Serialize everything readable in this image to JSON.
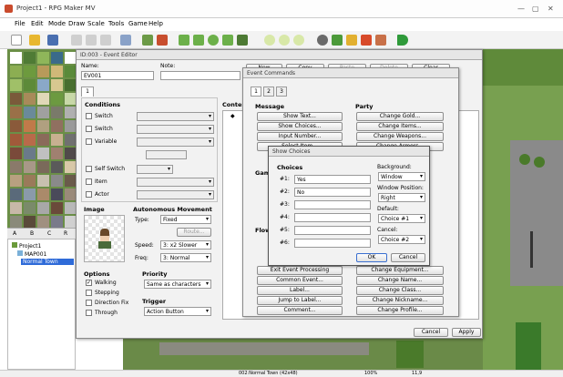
{
  "window": {
    "title": "Project1 - RPG Maker MV",
    "controls": [
      "—",
      "▢",
      "✕"
    ]
  },
  "menu": [
    "File",
    "Edit",
    "Mode",
    "Draw",
    "Scale",
    "Tools",
    "Game",
    "Help"
  ],
  "tile_tabs": [
    "A",
    "B",
    "C",
    "R"
  ],
  "map_tree": [
    {
      "label": "Project1"
    },
    {
      "label": "MAP001"
    },
    {
      "label": "Normal Town"
    }
  ],
  "status": {
    "map": "002:Normal Town (42x48)",
    "zoom": "100%",
    "coords": "11,9"
  },
  "event_editor": {
    "title": "ID:003 - Event Editor",
    "name_label": "Name:",
    "name_value": "EV001",
    "note_label": "Note:",
    "page_tab": "1",
    "new_btn": "New",
    "copy_btn": "Copy",
    "paste_btn": "Paste",
    "delete_btn": "Delete",
    "clear_btn": "Clear",
    "conditions_title": "Conditions",
    "conditions": [
      "Switch",
      "Switch",
      "Variable",
      "Self Switch",
      "Item",
      "Actor"
    ],
    "contents_title": "Contents",
    "contents_marker": "◆",
    "image_title": "Image",
    "movement_title": "Autonomous Movement",
    "type_label": "Type:",
    "type_value": "Fixed",
    "route_btn": "Route...",
    "speed_label": "Speed:",
    "speed_value": "3: x2 Slower",
    "freq_label": "Freq:",
    "freq_value": "3: Normal",
    "options_title": "Options",
    "options": [
      {
        "label": "Walking",
        "checked": true
      },
      {
        "label": "Stepping",
        "checked": false
      },
      {
        "label": "Direction Fix",
        "checked": false
      },
      {
        "label": "Through",
        "checked": false
      }
    ],
    "priority_title": "Priority",
    "priority_value": "Same as characters",
    "trigger_title": "Trigger",
    "trigger_value": "Action Button",
    "cancel_btn": "Cancel",
    "apply_btn": "Apply"
  },
  "event_commands": {
    "title": "Event Commands",
    "tabs": [
      "1",
      "2",
      "3"
    ],
    "message_title": "Message",
    "message": [
      "Show Text...",
      "Show Choices...",
      "Input Number...",
      "Select Item..."
    ],
    "party_title": "Party",
    "party": [
      "Change Gold...",
      "Change Items...",
      "Change Weapons...",
      "Change Armors..."
    ],
    "game_title": "Gam",
    "flow_title": "Flow",
    "flow": [
      "Exit Event Processing",
      "Common Event...",
      "Label...",
      "Jump to Label...",
      "Comment..."
    ],
    "actor": [
      "Change Equipment...",
      "Change Name...",
      "Change Class...",
      "Change Nickname...",
      "Change Profile..."
    ]
  },
  "show_choices": {
    "title": "Show Choices",
    "choices_label": "Choices",
    "rows": [
      {
        "label": "#1:",
        "value": "Yes"
      },
      {
        "label": "#2:",
        "value": "No"
      },
      {
        "label": "#3:",
        "value": ""
      },
      {
        "label": "#4:",
        "value": ""
      },
      {
        "label": "#5:",
        "value": ""
      },
      {
        "label": "#6:",
        "value": ""
      }
    ],
    "background_label": "Background:",
    "background_value": "Window",
    "position_label": "Window Position:",
    "position_value": "Right",
    "default_label": "Default:",
    "default_value": "Choice #1",
    "cancel_label": "Cancel:",
    "cancel_value": "Choice #2",
    "ok_btn": "OK",
    "cancel_btn": "Cancel"
  }
}
